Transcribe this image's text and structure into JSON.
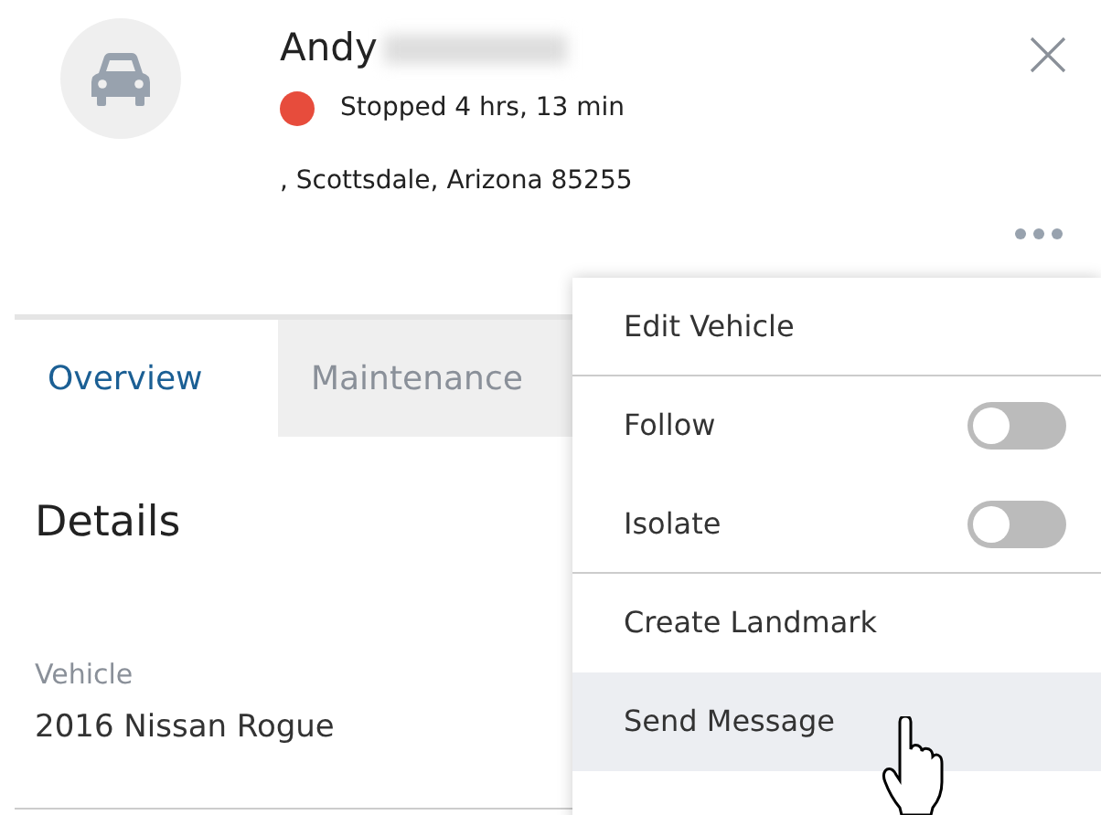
{
  "header": {
    "name": "Andy",
    "status": {
      "text": "Stopped 4 hrs, 13 min",
      "color": "#e74c3c"
    },
    "address": ", Scottsdale, Arizona 85255"
  },
  "tabs": [
    {
      "label": "Overview",
      "selected": true
    },
    {
      "label": "Maintenance",
      "selected": false
    }
  ],
  "details": {
    "title": "Details",
    "fields": [
      {
        "label": "Vehicle",
        "value": "2016 Nissan Rogue"
      }
    ]
  },
  "menu": {
    "items": [
      {
        "kind": "action",
        "label": "Edit Vehicle",
        "highlighted": false,
        "divider_after": true
      },
      {
        "kind": "toggle",
        "label": "Follow",
        "on": false,
        "highlighted": false,
        "divider_after": false
      },
      {
        "kind": "toggle",
        "label": "Isolate",
        "on": false,
        "highlighted": false,
        "divider_after": true
      },
      {
        "kind": "action",
        "label": "Create Landmark",
        "highlighted": false,
        "divider_after": false
      },
      {
        "kind": "action",
        "label": "Send Message",
        "highlighted": true,
        "divider_after": false
      }
    ]
  }
}
